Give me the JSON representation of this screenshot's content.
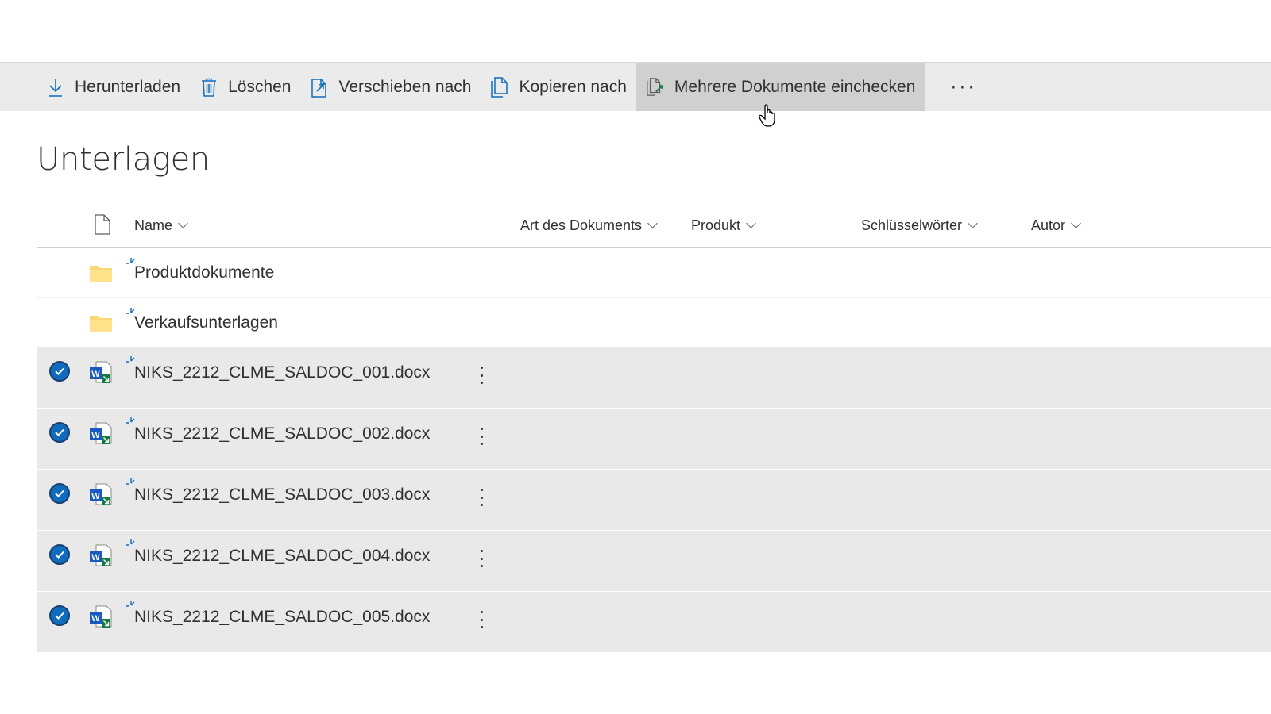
{
  "toolbar": {
    "download_label": "Herunterladen",
    "delete_label": "Löschen",
    "move_label": "Verschieben nach",
    "copy_label": "Kopieren nach",
    "checkin_label": "Mehrere Dokumente einchecken",
    "more_label": "···"
  },
  "page": {
    "title": "Unterlagen"
  },
  "columns": {
    "name": "Name",
    "doc_type": "Art des Dokuments",
    "product": "Produkt",
    "keywords": "Schlüsselwörter",
    "author": "Autor"
  },
  "folders": [
    {
      "name": "Produktdokumente"
    },
    {
      "name": "Verkaufsunterlagen"
    }
  ],
  "files": [
    {
      "name": "NIKS_2212_CLME_SALDOC_001.docx",
      "selected": true
    },
    {
      "name": "NIKS_2212_CLME_SALDOC_002.docx",
      "selected": true
    },
    {
      "name": "NIKS_2212_CLME_SALDOC_003.docx",
      "selected": true
    },
    {
      "name": "NIKS_2212_CLME_SALDOC_004.docx",
      "selected": true
    },
    {
      "name": "NIKS_2212_CLME_SALDOC_005.docx",
      "selected": true
    }
  ],
  "colors": {
    "accent": "#0f6cbd",
    "toolbar_bg": "#ebebeb",
    "selected_row_bg": "#e9e9e9",
    "folder": "#f8d775",
    "word_blue": "#185abd",
    "word_green": "#107c41"
  },
  "icons": {
    "download": "download-icon",
    "delete": "trash-icon",
    "move": "move-icon",
    "copy": "copy-icon",
    "checkin": "checkin-icon",
    "more": "more-icon",
    "file_type": "document-icon",
    "folder": "folder-icon",
    "word": "word-doc-icon",
    "new": "new-sparkle-icon",
    "selected": "checkmark-icon",
    "row_actions": "vertical-dots-icon",
    "sort": "chevron-down-icon",
    "cursor": "hand-cursor-icon"
  }
}
